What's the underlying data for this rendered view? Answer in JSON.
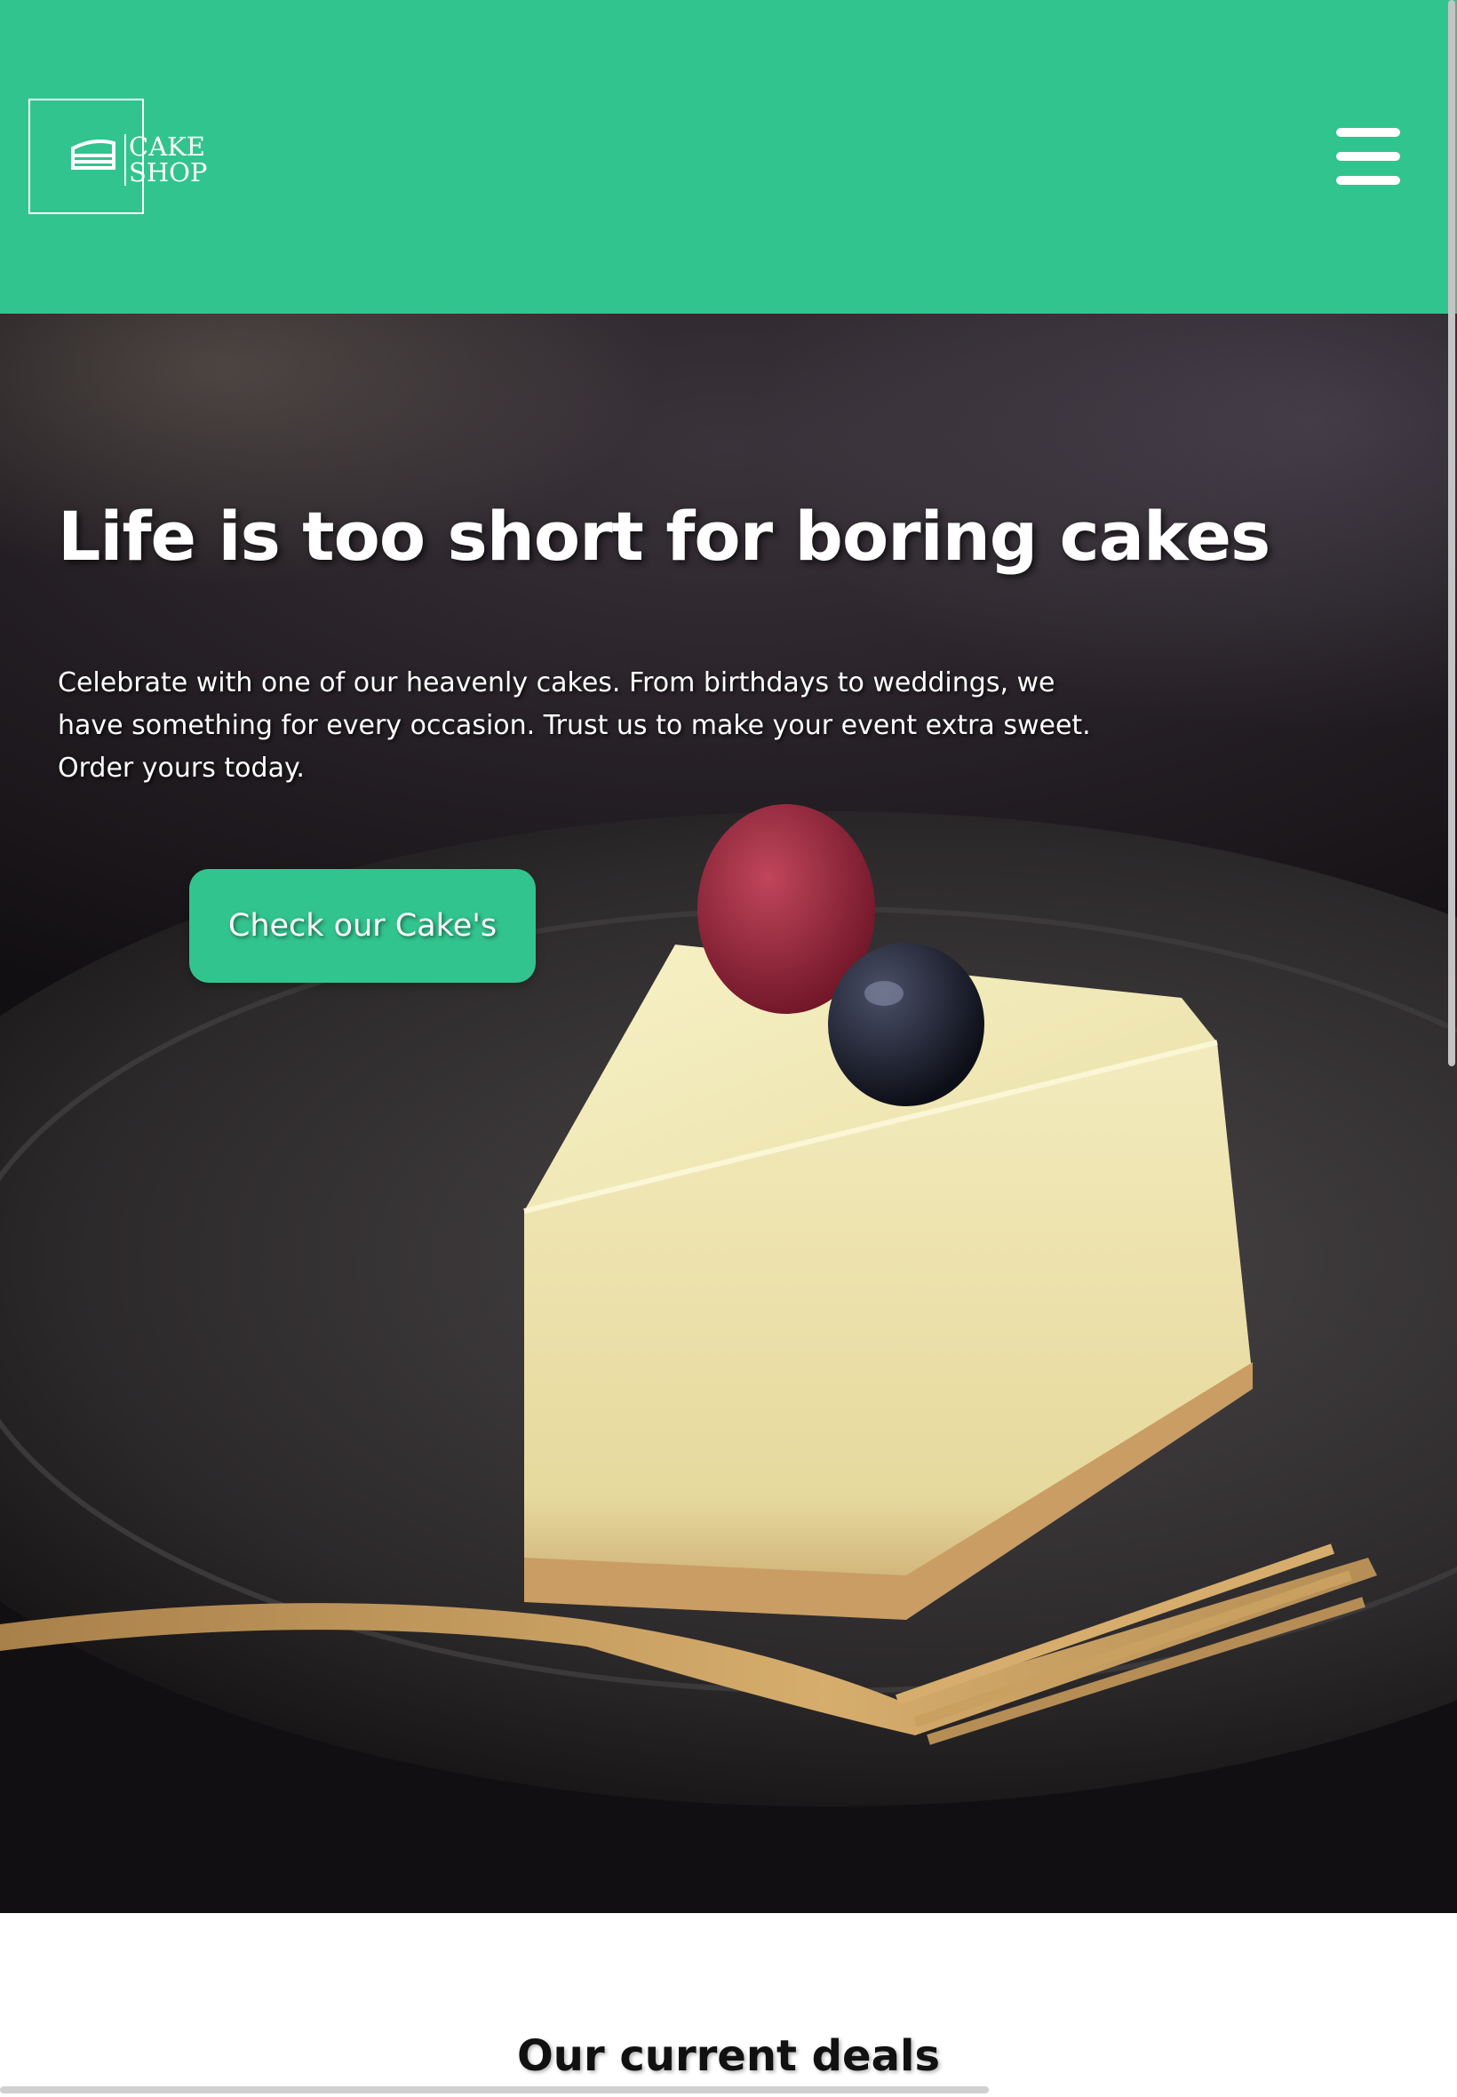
{
  "header": {
    "logo": {
      "line1": "CAKE",
      "line2": "SHOP",
      "icon": "cake-slice-icon"
    },
    "menu": {
      "icon": "hamburger-menu-icon"
    },
    "background_color": "#32c48e"
  },
  "hero": {
    "title": "Life is too short for boring cakes",
    "text": "Celebrate with one of our heavenly cakes. From birthdays to weddings, we have something for every occasion. Trust us to make your event extra sweet. Order yours today.",
    "cta_label": "Check our Cake's",
    "image": "cheesecake-with-berries-and-fork-photo"
  },
  "deals": {
    "title": "Our current deals"
  },
  "colors": {
    "accent": "#32c48e",
    "text_light": "#ffffff",
    "text_dark": "#111111"
  }
}
